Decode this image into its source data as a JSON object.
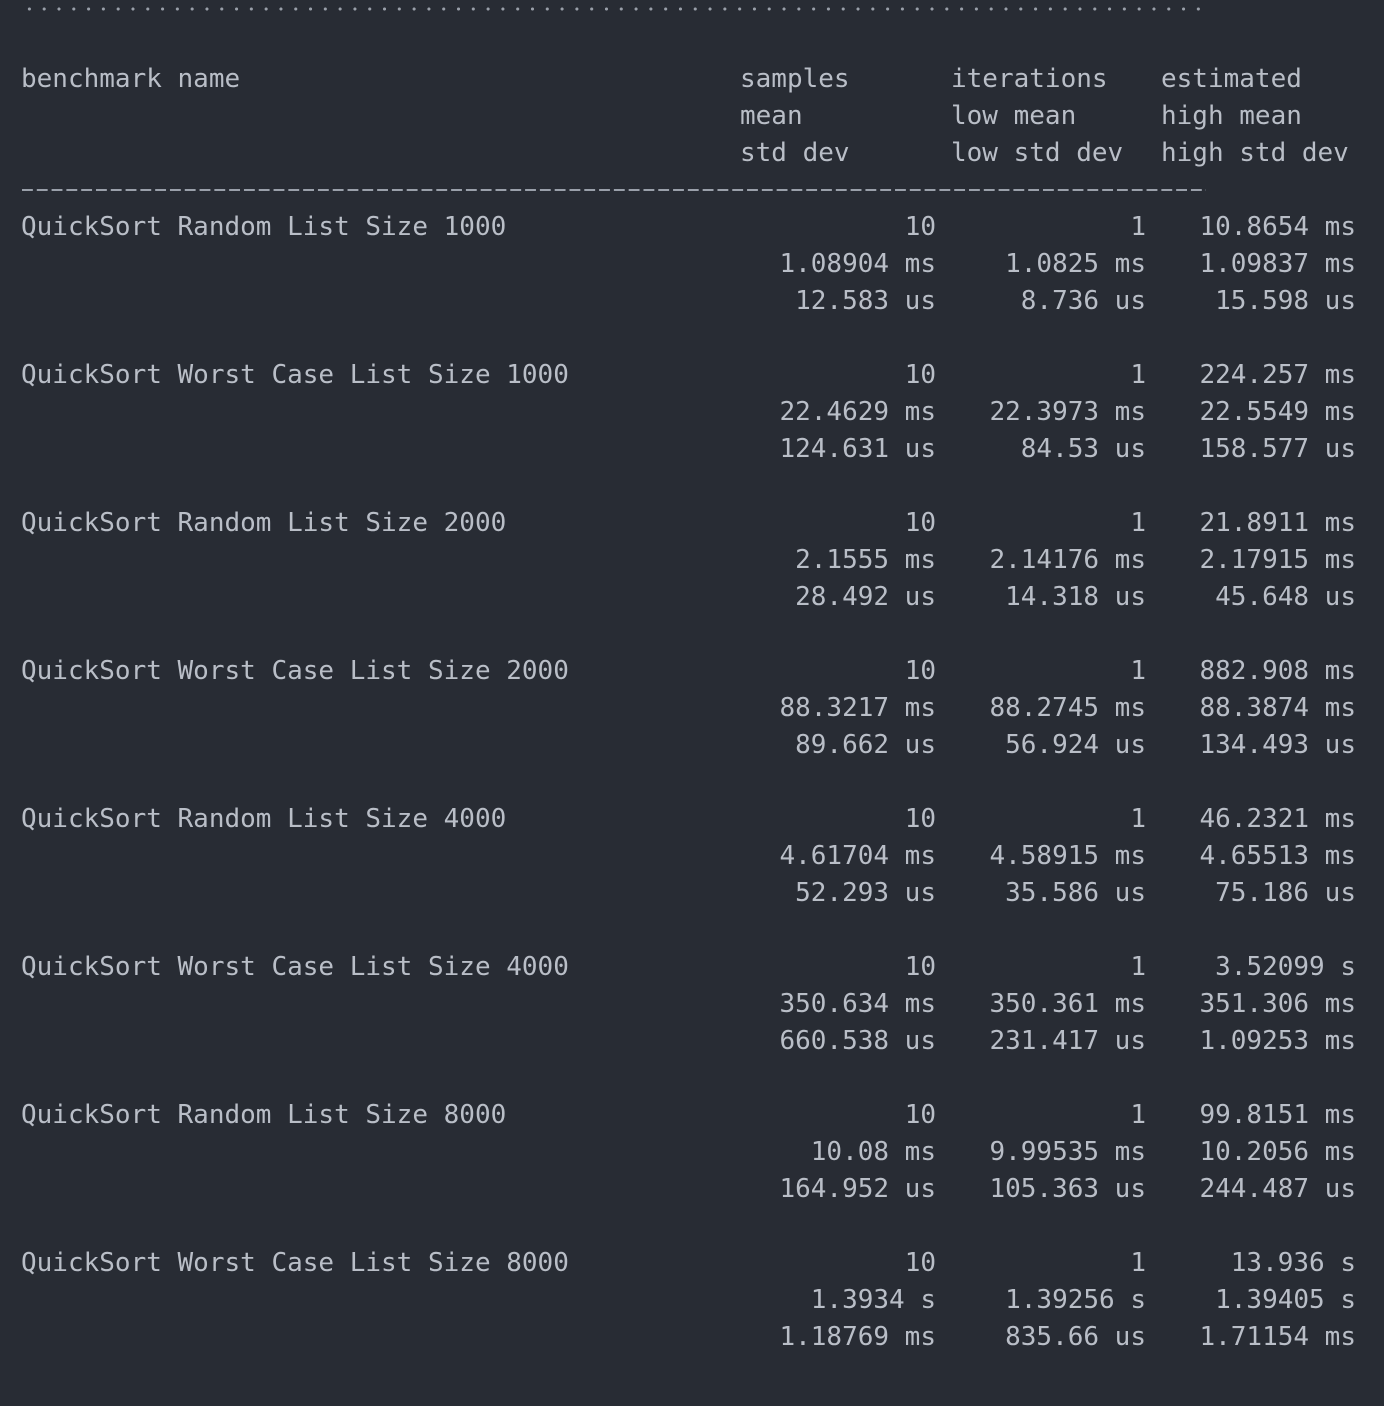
{
  "header": {
    "name": "benchmark name",
    "c1": [
      "samples",
      "mean",
      "std dev"
    ],
    "c2": [
      "iterations",
      "low mean",
      "low std dev"
    ],
    "c3": [
      "estimated",
      "high mean",
      "high std dev"
    ]
  },
  "rows": [
    {
      "name": "QuickSort Random List Size 1000",
      "samples": "10",
      "iterations": "1",
      "estimated": "10.8654 ms",
      "mean": "1.08904 ms",
      "low_mean": "1.0825 ms",
      "high_mean": "1.09837 ms",
      "std_dev": "12.583 us",
      "low_std_dev": "8.736 us",
      "high_std_dev": "15.598 us"
    },
    {
      "name": "QuickSort Worst Case List Size 1000",
      "samples": "10",
      "iterations": "1",
      "estimated": "224.257 ms",
      "mean": "22.4629 ms",
      "low_mean": "22.3973 ms",
      "high_mean": "22.5549 ms",
      "std_dev": "124.631 us",
      "low_std_dev": "84.53 us",
      "high_std_dev": "158.577 us"
    },
    {
      "name": "QuickSort Random List Size 2000",
      "samples": "10",
      "iterations": "1",
      "estimated": "21.8911 ms",
      "mean": "2.1555 ms",
      "low_mean": "2.14176 ms",
      "high_mean": "2.17915 ms",
      "std_dev": "28.492 us",
      "low_std_dev": "14.318 us",
      "high_std_dev": "45.648 us"
    },
    {
      "name": "QuickSort Worst Case List Size 2000",
      "samples": "10",
      "iterations": "1",
      "estimated": "882.908 ms",
      "mean": "88.3217 ms",
      "low_mean": "88.2745 ms",
      "high_mean": "88.3874 ms",
      "std_dev": "89.662 us",
      "low_std_dev": "56.924 us",
      "high_std_dev": "134.493 us"
    },
    {
      "name": "QuickSort Random List Size 4000",
      "samples": "10",
      "iterations": "1",
      "estimated": "46.2321 ms",
      "mean": "4.61704 ms",
      "low_mean": "4.58915 ms",
      "high_mean": "4.65513 ms",
      "std_dev": "52.293 us",
      "low_std_dev": "35.586 us",
      "high_std_dev": "75.186 us"
    },
    {
      "name": "QuickSort Worst Case List Size 4000",
      "samples": "10",
      "iterations": "1",
      "estimated": "3.52099 s",
      "mean": "350.634 ms",
      "low_mean": "350.361 ms",
      "high_mean": "351.306 ms",
      "std_dev": "660.538 us",
      "low_std_dev": "231.417 us",
      "high_std_dev": "1.09253 ms"
    },
    {
      "name": "QuickSort Random List Size 8000",
      "samples": "10",
      "iterations": "1",
      "estimated": "99.8151 ms",
      "mean": "10.08 ms",
      "low_mean": "9.99535 ms",
      "high_mean": "10.2056 ms",
      "std_dev": "164.952 us",
      "low_std_dev": "105.363 us",
      "high_std_dev": "244.487 us"
    },
    {
      "name": "QuickSort Worst Case List Size 8000",
      "samples": "10",
      "iterations": "1",
      "estimated": "13.936 s",
      "mean": "1.3934 s",
      "low_mean": "1.39256 s",
      "high_mean": "1.39405 s",
      "std_dev": "1.18769 ms",
      "low_std_dev": "835.66 us",
      "high_std_dev": "1.71154 ms"
    }
  ]
}
